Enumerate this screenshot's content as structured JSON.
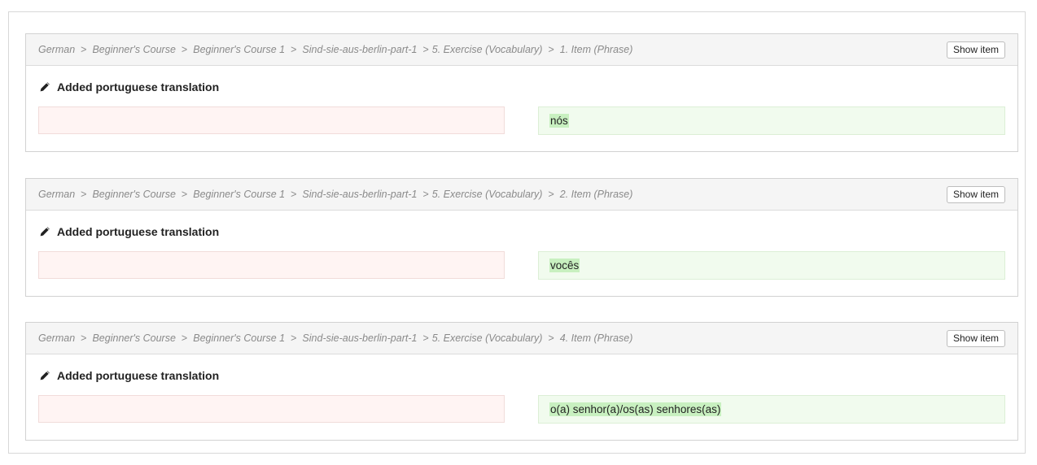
{
  "items": [
    {
      "breadcrumb": [
        "German",
        "Beginner's Course",
        "Beginner's Course 1",
        "Sind-sie-aus-berlin-part-1",
        "5. Exercise (Vocabulary)",
        "1. Item (Phrase)"
      ],
      "show_label": "Show item",
      "action": "Added portuguese translation",
      "old_value": "",
      "new_value": "nós"
    },
    {
      "breadcrumb": [
        "German",
        "Beginner's Course",
        "Beginner's Course 1",
        "Sind-sie-aus-berlin-part-1",
        "5. Exercise (Vocabulary)",
        "2. Item (Phrase)"
      ],
      "show_label": "Show item",
      "action": "Added portuguese translation",
      "old_value": "",
      "new_value": "vocês"
    },
    {
      "breadcrumb": [
        "German",
        "Beginner's Course",
        "Beginner's Course 1",
        "Sind-sie-aus-berlin-part-1",
        "5. Exercise (Vocabulary)",
        "4. Item (Phrase)"
      ],
      "show_label": "Show item",
      "action": "Added portuguese translation",
      "old_value": "",
      "new_value": "o(a) senhor(a)/os(as) senhores(as)"
    }
  ],
  "separator": ">",
  "icons": {
    "action": "pencil-icon"
  },
  "colors": {
    "removed_bg": "#fff4f3",
    "added_bg": "#f1fbee",
    "added_highlight": "#c8f0c0"
  }
}
